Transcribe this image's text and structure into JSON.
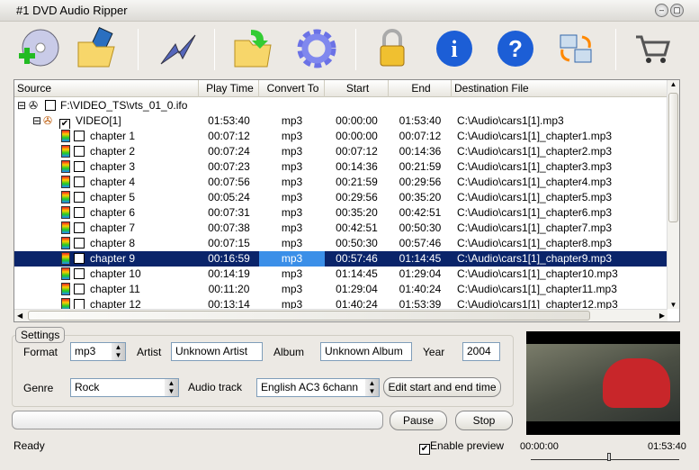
{
  "window": {
    "title": "#1 DVD Audio Ripper"
  },
  "toolbar": [
    {
      "name": "add-dvd-button",
      "icon": "disc-add-icon"
    },
    {
      "name": "open-video-button",
      "icon": "folder-film-icon"
    },
    {
      "name": "convert-button",
      "icon": "lightning-icon"
    },
    {
      "name": "output-folder-button",
      "icon": "folder-arrow-icon"
    },
    {
      "name": "settings-button",
      "icon": "gear-icon"
    },
    {
      "name": "register-button",
      "icon": "lock-icon"
    },
    {
      "name": "about-button",
      "icon": "info-icon"
    },
    {
      "name": "help-button",
      "icon": "help-icon"
    },
    {
      "name": "switch-button",
      "icon": "swap-icon"
    },
    {
      "name": "buy-button",
      "icon": "cart-icon"
    }
  ],
  "table": {
    "columns": [
      "Source",
      "Play Time",
      "Convert To",
      "Start",
      "End",
      "Destination File"
    ],
    "root": {
      "label": "F:\\VIDEO_TS\\vts_01_0.ifo",
      "checked": false
    },
    "video": {
      "label": "VIDEO[1]",
      "checked": true,
      "play_time": "01:53:40",
      "convert_to": "mp3",
      "start": "00:00:00",
      "end": "01:53:40",
      "dest": "C:\\Audio\\cars1[1].mp3"
    },
    "rows": [
      {
        "label": "chapter 1",
        "play_time": "00:07:12",
        "convert_to": "mp3",
        "start": "00:00:00",
        "end": "00:07:12",
        "dest": "C:\\Audio\\cars1[1]_chapter1.mp3"
      },
      {
        "label": "chapter 2",
        "play_time": "00:07:24",
        "convert_to": "mp3",
        "start": "00:07:12",
        "end": "00:14:36",
        "dest": "C:\\Audio\\cars1[1]_chapter2.mp3"
      },
      {
        "label": "chapter 3",
        "play_time": "00:07:23",
        "convert_to": "mp3",
        "start": "00:14:36",
        "end": "00:21:59",
        "dest": "C:\\Audio\\cars1[1]_chapter3.mp3"
      },
      {
        "label": "chapter 4",
        "play_time": "00:07:56",
        "convert_to": "mp3",
        "start": "00:21:59",
        "end": "00:29:56",
        "dest": "C:\\Audio\\cars1[1]_chapter4.mp3"
      },
      {
        "label": "chapter 5",
        "play_time": "00:05:24",
        "convert_to": "mp3",
        "start": "00:29:56",
        "end": "00:35:20",
        "dest": "C:\\Audio\\cars1[1]_chapter5.mp3"
      },
      {
        "label": "chapter 6",
        "play_time": "00:07:31",
        "convert_to": "mp3",
        "start": "00:35:20",
        "end": "00:42:51",
        "dest": "C:\\Audio\\cars1[1]_chapter6.mp3"
      },
      {
        "label": "chapter 7",
        "play_time": "00:07:38",
        "convert_to": "mp3",
        "start": "00:42:51",
        "end": "00:50:30",
        "dest": "C:\\Audio\\cars1[1]_chapter7.mp3"
      },
      {
        "label": "chapter 8",
        "play_time": "00:07:15",
        "convert_to": "mp3",
        "start": "00:50:30",
        "end": "00:57:46",
        "dest": "C:\\Audio\\cars1[1]_chapter8.mp3"
      },
      {
        "label": "chapter 9",
        "play_time": "00:16:59",
        "convert_to": "mp3",
        "start": "00:57:46",
        "end": "01:14:45",
        "dest": "C:\\Audio\\cars1[1]_chapter9.mp3",
        "selected": true
      },
      {
        "label": "chapter 10",
        "play_time": "00:14:19",
        "convert_to": "mp3",
        "start": "01:14:45",
        "end": "01:29:04",
        "dest": "C:\\Audio\\cars1[1]_chapter10.mp3"
      },
      {
        "label": "chapter 11",
        "play_time": "00:11:20",
        "convert_to": "mp3",
        "start": "01:29:04",
        "end": "01:40:24",
        "dest": "C:\\Audio\\cars1[1]_chapter11.mp3"
      },
      {
        "label": "chapter 12",
        "play_time": "00:13:14",
        "convert_to": "mp3",
        "start": "01:40:24",
        "end": "01:53:39",
        "dest": "C:\\Audio\\cars1[1]_chapter12.mp3"
      }
    ]
  },
  "settings": {
    "legend": "Settings",
    "format_label": "Format",
    "format_value": "mp3",
    "artist_label": "Artist",
    "artist_value": "Unknown Artist",
    "album_label": "Album",
    "album_value": "Unknown Album",
    "year_label": "Year",
    "year_value": "2004",
    "genre_label": "Genre",
    "genre_value": "Rock",
    "audio_track_label": "Audio track",
    "audio_track_value": "English AC3 6chann",
    "edit_time_button": "Edit start and end time"
  },
  "controls": {
    "pause": "Pause",
    "stop": "Stop",
    "progress": 0
  },
  "status": {
    "text": "Ready",
    "enable_preview_label": "Enable preview",
    "enable_preview": true
  },
  "preview": {
    "time_start": "00:00:00",
    "time_end": "01:53:40"
  },
  "colors": {
    "selection": "#0a246a",
    "selected_cell": "#3b8fe8"
  }
}
